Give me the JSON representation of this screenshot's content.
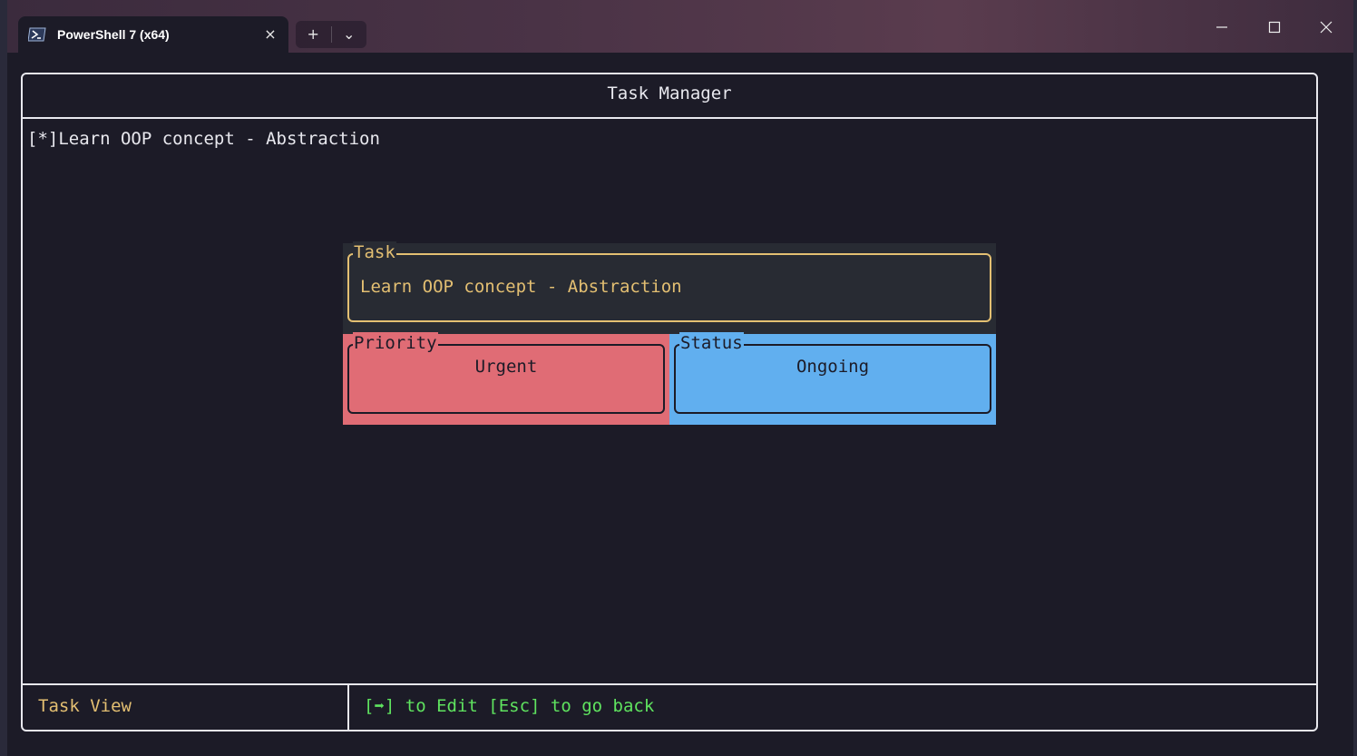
{
  "window": {
    "tab_title": "PowerShell 7 (x64)",
    "tab_close_icon": "×",
    "new_tab_icon": "+",
    "dropdown_icon": "⌄",
    "minimize_icon": "—",
    "maximize_icon": "☐",
    "close_icon": "✕"
  },
  "app": {
    "title": "Task Manager",
    "list": [
      {
        "marker": "[*]",
        "text": "Learn OOP concept - Abstraction"
      }
    ],
    "detail": {
      "task_label": "Task",
      "task_text": "Learn OOP concept - Abstraction",
      "priority_label": "Priority",
      "priority_value": "Urgent",
      "status_label": "Status",
      "status_value": "Ongoing"
    },
    "footer": {
      "mode": "Task View",
      "hint": "[➡] to Edit [Esc] to go back"
    }
  },
  "colors": {
    "background": "#1c1b27",
    "border": "#e8e8ee",
    "task_accent": "#e3bf72",
    "priority_urgent": "#e06c75",
    "status_ongoing": "#61afef",
    "hint_green": "#5fe35f"
  }
}
